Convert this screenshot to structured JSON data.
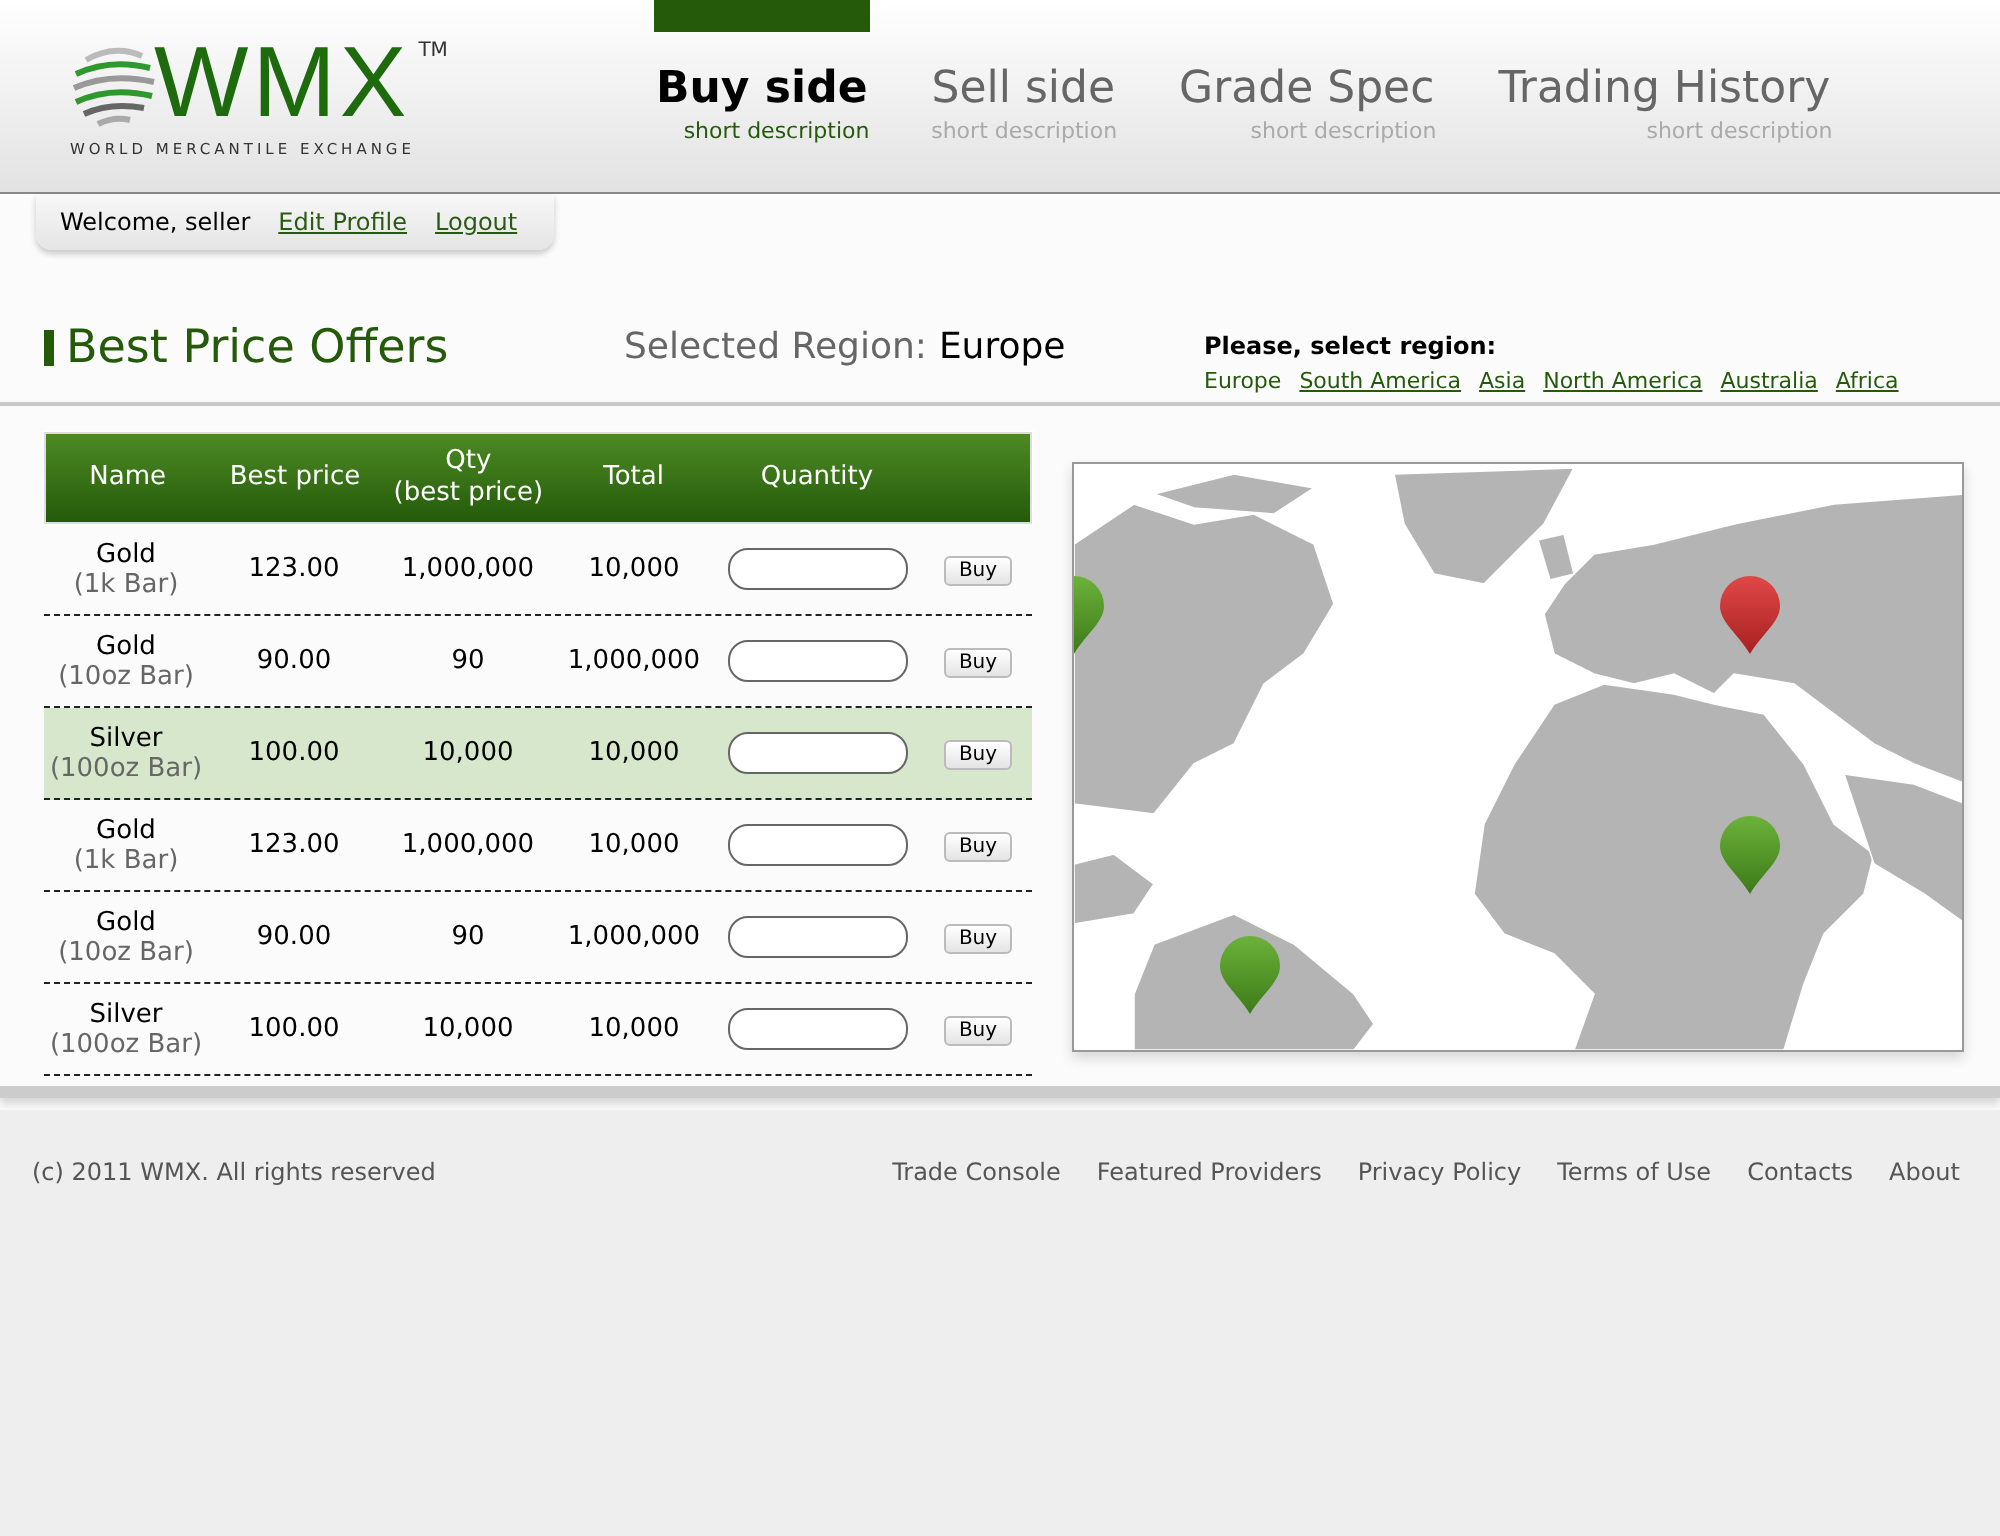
{
  "logo": {
    "wordmark": "WMX",
    "trademark": "TM",
    "tagline": "WORLD MERCANTILE EXCHANGE"
  },
  "nav": [
    {
      "label": "Buy side",
      "description": "short description",
      "selected": true
    },
    {
      "label": "Sell side",
      "description": "short description",
      "selected": false
    },
    {
      "label": "Grade Spec",
      "description": "short description",
      "selected": false
    },
    {
      "label": "Trading History",
      "description": "short description",
      "selected": false
    }
  ],
  "user_bar": {
    "welcome": "Welcome, seller",
    "links": [
      "Edit Profile",
      "Logout"
    ]
  },
  "title": "Best Price Offers",
  "selected_region": {
    "label": "Selected Region:",
    "value": "Europe"
  },
  "region_picker": {
    "prompt": "Please, select region:",
    "regions": [
      {
        "label": "Europe",
        "selected": true
      },
      {
        "label": "South America",
        "selected": false
      },
      {
        "label": "Asia",
        "selected": false
      },
      {
        "label": "North America",
        "selected": false
      },
      {
        "label": "Australia",
        "selected": false
      },
      {
        "label": "Africa",
        "selected": false
      }
    ]
  },
  "table": {
    "columns": [
      "Name",
      "Best price",
      "Qty\n(best price)",
      "Total",
      "Quantity"
    ],
    "rows": [
      {
        "name": "Gold",
        "unit": "(1k Bar)",
        "best_price": "123.00",
        "qty": "1,000,000",
        "total": "10,000",
        "button": "Buy",
        "selected": false
      },
      {
        "name": "Gold",
        "unit": "(10oz Bar)",
        "best_price": "90.00",
        "qty": "90",
        "total": "1,000,000",
        "button": "Buy",
        "selected": false
      },
      {
        "name": "Silver",
        "unit": "(100oz Bar)",
        "best_price": "100.00",
        "qty": "10,000",
        "total": "10,000",
        "button": "Buy",
        "selected": true
      },
      {
        "name": "Gold",
        "unit": "(1k Bar)",
        "best_price": "123.00",
        "qty": "1,000,000",
        "total": "10,000",
        "button": "Buy",
        "selected": false
      },
      {
        "name": "Gold",
        "unit": "(10oz Bar)",
        "best_price": "90.00",
        "qty": "90",
        "total": "1,000,000",
        "button": "Buy",
        "selected": false
      },
      {
        "name": "Silver",
        "unit": "(100oz Bar)",
        "best_price": "100.00",
        "qty": "10,000",
        "total": "10,000",
        "button": "Buy",
        "selected": false
      }
    ]
  },
  "map": {
    "pins": [
      {
        "selected": false
      },
      {
        "selected": true
      },
      {
        "selected": false
      },
      {
        "selected": false
      }
    ]
  },
  "footer": {
    "copyright": "(c) 2011 WMX. All rights reserved",
    "links": [
      "Trade Console",
      "Featured Providers",
      "Privacy Policy",
      "Terms of Use",
      "Contacts",
      "About"
    ]
  }
}
